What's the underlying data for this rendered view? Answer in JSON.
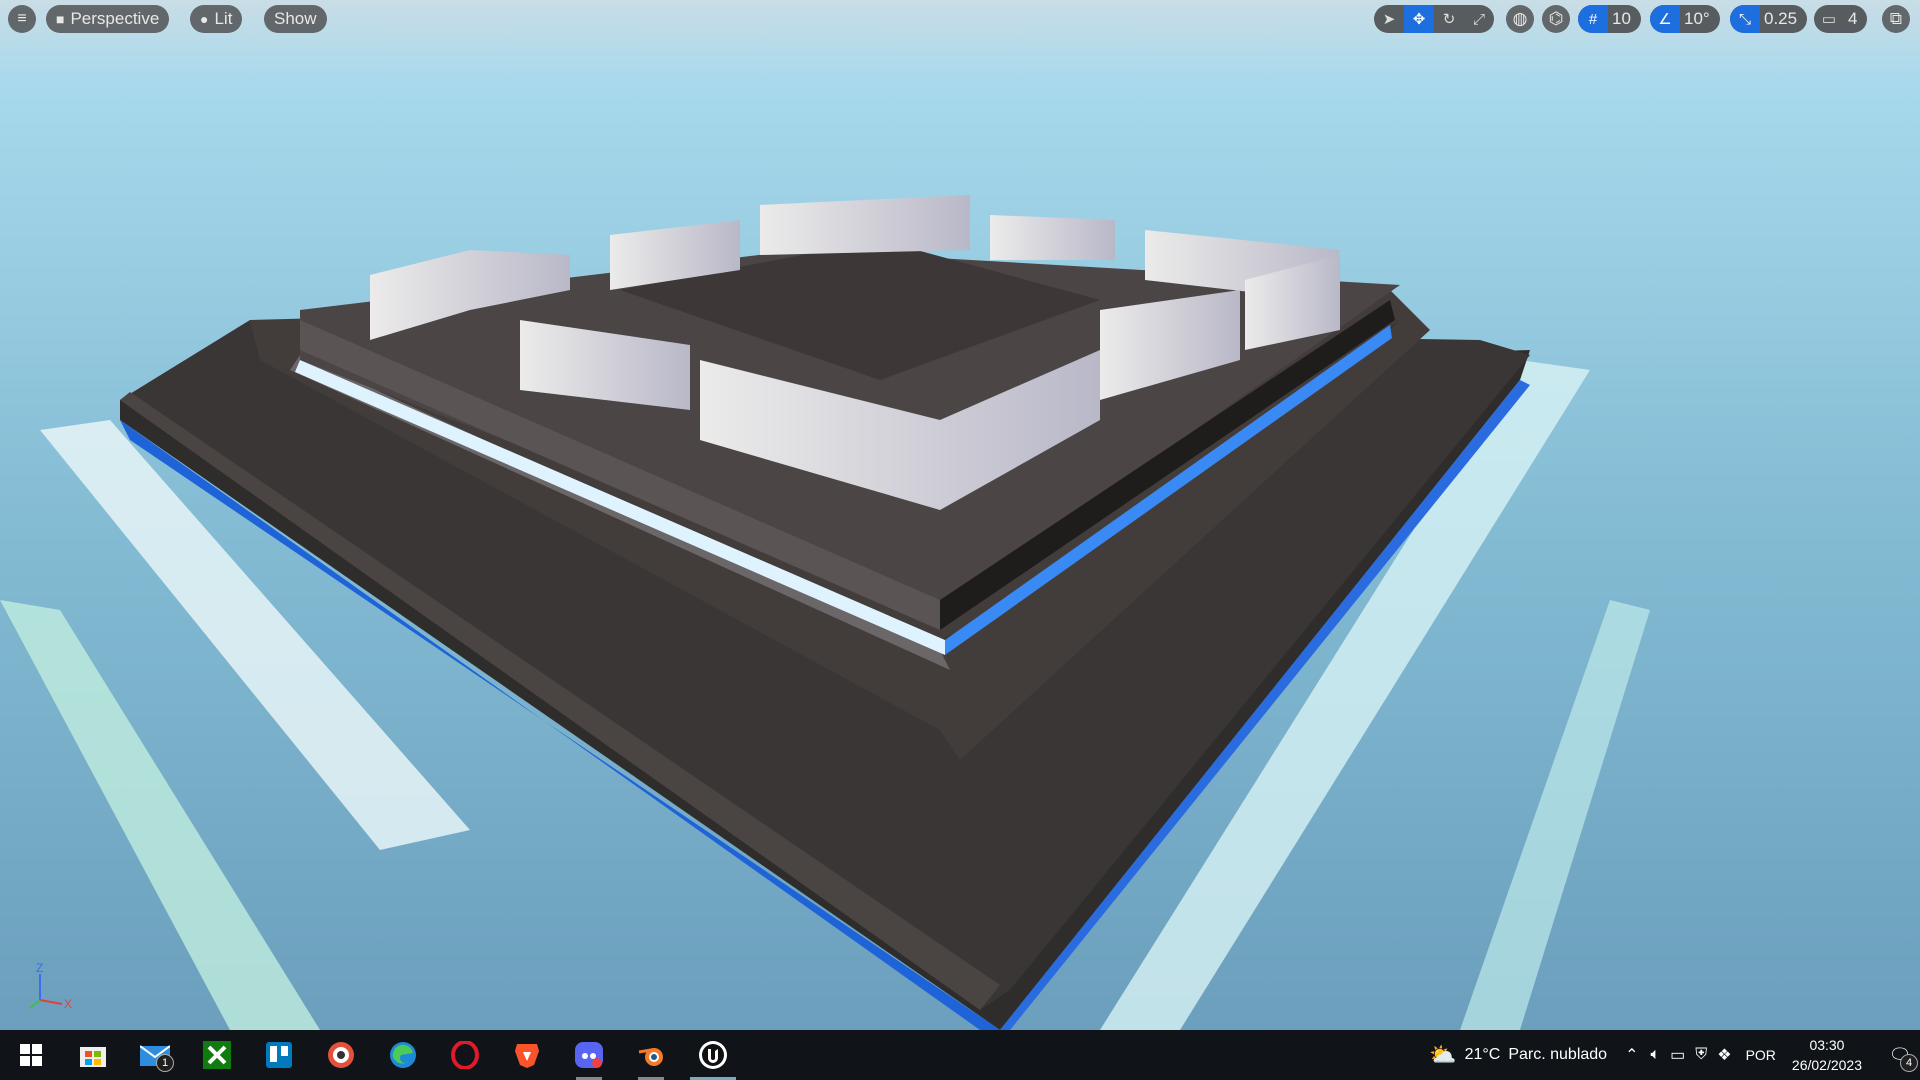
{
  "toolbar": {
    "menu_icon": "hamburger-icon",
    "view_mode": "Perspective",
    "lighting": "Lit",
    "show": "Show",
    "grid_snap": "10",
    "rotation_snap": "10°",
    "scale_snap": "0.25",
    "camera_speed": "4"
  },
  "axis": {
    "z": "Z",
    "x": "X"
  },
  "taskbar": {
    "mail_badge": "1",
    "weather_temp": "21°C",
    "weather_desc": "Parc. nublado",
    "language": "POR",
    "time": "03:30",
    "date": "26/02/2023",
    "notification_count": "4"
  },
  "colors": {
    "accent": "#1d6fe0",
    "sky": "#9ed3ea",
    "water": "#6fa8c4",
    "platform": "#3e3836"
  }
}
